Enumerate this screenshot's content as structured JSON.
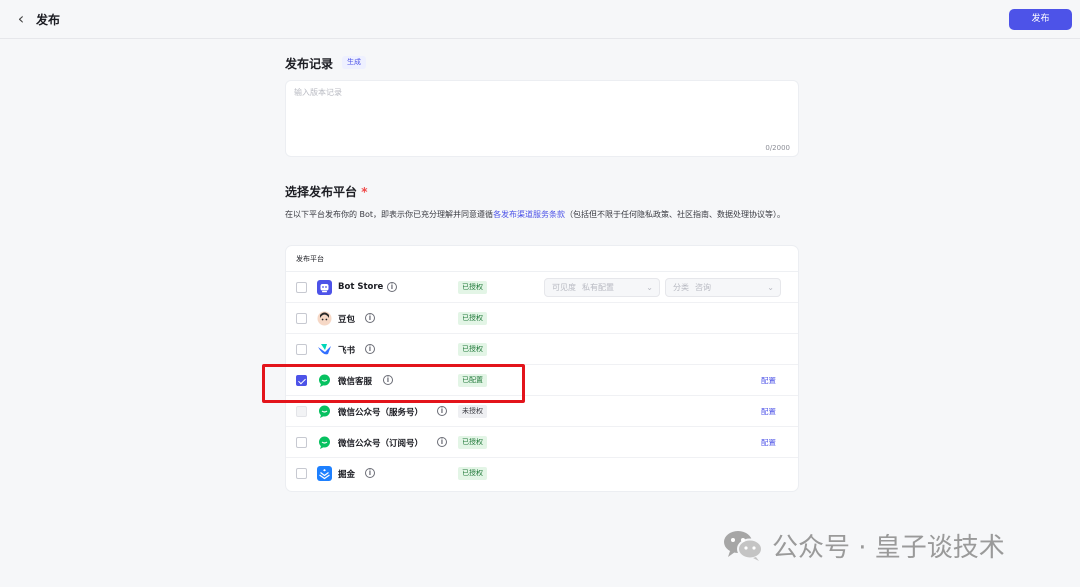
{
  "header": {
    "back_icon": "chevron-left-icon",
    "title": "发布",
    "publish_label": "发布"
  },
  "record": {
    "title": "发布记录",
    "generate_label": "生成",
    "placeholder": "输入版本记录",
    "value": "",
    "counter": "0/2000"
  },
  "platform_section": {
    "title": "选择发布平台",
    "required_mark": "*",
    "desc_prefix": "在以下平台发布你的 Bot，即表示你已充分理解并同意遵循",
    "desc_link": "各发布渠道服务条款",
    "desc_suffix": "（包括但不限于任何隐私政策、社区指南、数据处理协议等）。"
  },
  "table": {
    "header": "发布平台",
    "rows": [
      {
        "name": "Bot Store",
        "status": "已授权",
        "checked": false,
        "disabled": false,
        "config": "",
        "icon": "bot-store-icon",
        "color": "#4d53e8"
      },
      {
        "name": "豆包",
        "status": "已授权",
        "checked": false,
        "disabled": false,
        "config": "",
        "icon": "doubao-icon",
        "color": "#f1c9b2"
      },
      {
        "name": "飞书",
        "status": "已授权",
        "checked": false,
        "disabled": false,
        "config": "",
        "icon": "feishu-icon",
        "color": "#3370ff"
      },
      {
        "name": "微信客服",
        "status": "已配置",
        "checked": true,
        "disabled": false,
        "config": "配置",
        "icon": "wechat-icon",
        "color": "#07c160"
      },
      {
        "name": "微信公众号（服务号）",
        "status": "未授权",
        "checked": false,
        "disabled": true,
        "config": "配置",
        "icon": "wechat-icon",
        "color": "#07c160"
      },
      {
        "name": "微信公众号（订阅号）",
        "status": "已授权",
        "checked": false,
        "disabled": false,
        "config": "配置",
        "icon": "wechat-icon",
        "color": "#07c160"
      },
      {
        "name": "掘金",
        "status": "已授权",
        "checked": false,
        "disabled": false,
        "config": "",
        "icon": "juejin-icon",
        "color": "#1e80ff"
      }
    ],
    "visibility_select": {
      "label": "可见度",
      "value": "私有配置"
    },
    "category_select": {
      "label": "分类",
      "value": "咨询"
    }
  },
  "watermark": {
    "text": "公众号 · 皇子谈技术",
    "icon": "wechat-logo-icon"
  }
}
